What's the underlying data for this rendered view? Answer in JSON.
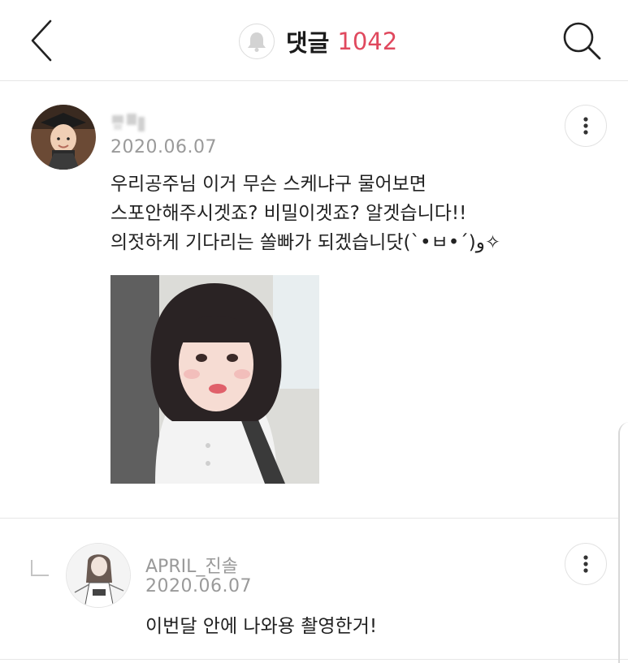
{
  "header": {
    "title": "댓글",
    "comment_count": "1042",
    "accent_color": "#e0495e",
    "icons": [
      "back-arrow-icon",
      "bell-icon",
      "search-icon"
    ]
  },
  "comments": [
    {
      "author": "",
      "author_obscured": true,
      "date": "2020.06.07",
      "text": "우리공주님 이거 무슨 스케냐구 물어보면\n스포안해주시겟죠? 비밀이겟죠? 알겟습니다!!\n의젓하게 기다리는 쏠빠가 되겠습니닷(`•ㅂ•´)و✧",
      "has_photo": true
    },
    {
      "author": "APRIL_진솔",
      "date": "2020.06.07",
      "text": "이번달 안에 나와용 촬영한거!",
      "is_reply": true
    }
  ]
}
